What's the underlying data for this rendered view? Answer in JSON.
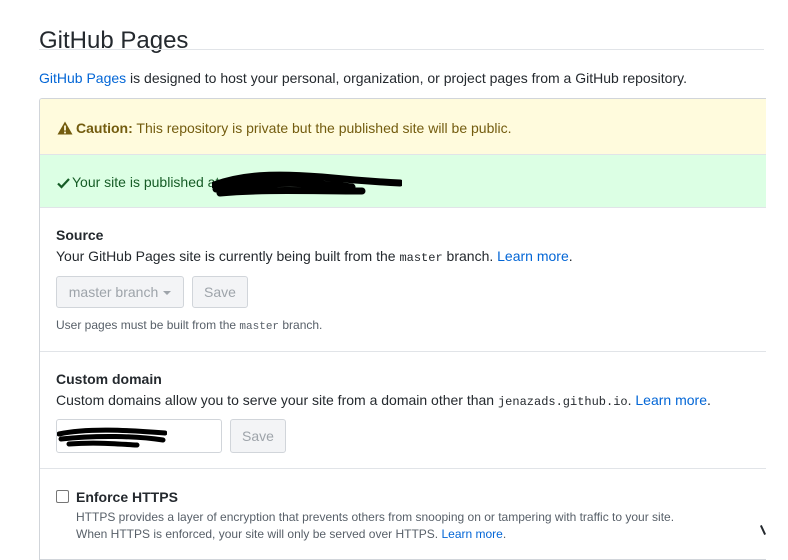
{
  "page": {
    "title": "GitHub Pages"
  },
  "intro": {
    "link": "GitHub Pages",
    "text": " is designed to host your personal, organization, or project pages from a GitHub repository."
  },
  "caution": {
    "label": "Caution:",
    "text": " This repository is private but the published site will be public."
  },
  "published": {
    "text": "Your site is published at"
  },
  "source": {
    "heading": "Source",
    "desc_before": "Your GitHub Pages site is currently being built from the ",
    "branch_code": "master",
    "desc_after": " branch. ",
    "learn_more": "Learn more",
    "period": ".",
    "dropdown_value": "master branch",
    "save_label": "Save",
    "note_before": "User pages must be built from the ",
    "note_code": "master",
    "note_after": " branch."
  },
  "custom_domain": {
    "heading": "Custom domain",
    "desc_before": "Custom domains allow you to serve your site from a domain other than ",
    "domain_code": "jenazads.github.io",
    "desc_after": ". ",
    "learn_more": "Learn more",
    "period": ".",
    "save_label": "Save"
  },
  "https": {
    "label": "Enforce HTTPS",
    "line1": "HTTPS provides a layer of encryption that prevents others from snooping on or tampering with traffic to your site.",
    "line2_before": "When HTTPS is enforced, your site will only be served over HTTPS. ",
    "learn_more": "Learn more",
    "period": "."
  },
  "colors": {
    "link": "#0366d6",
    "caution_bg": "#fffbdd",
    "success_bg": "#dcffe4",
    "border": "#d1d5da"
  },
  "icons": [
    "alert-icon",
    "check-icon",
    "caret-down-icon"
  ]
}
